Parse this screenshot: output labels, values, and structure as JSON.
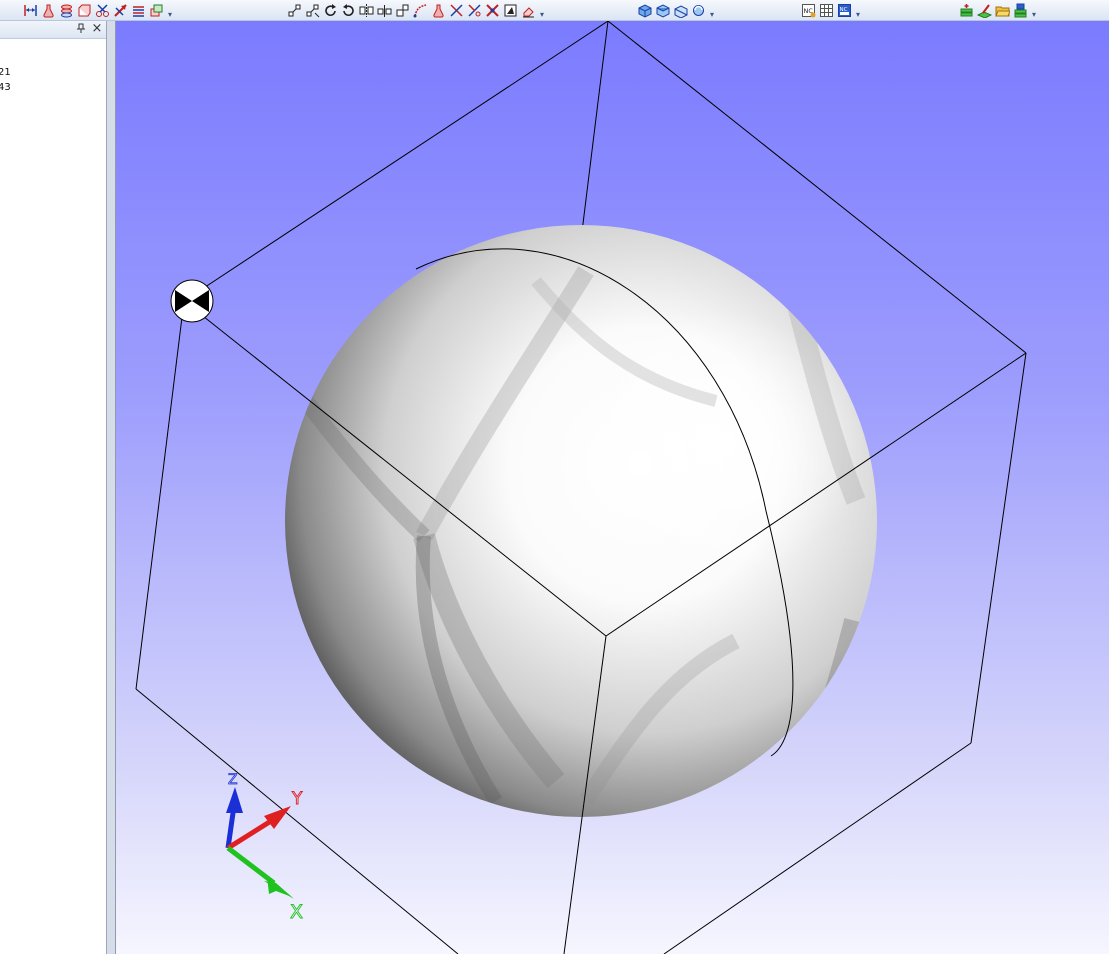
{
  "toolbar": {
    "groups": [
      {
        "id": "g1",
        "icons": [
          "dimension-icon",
          "flask-icon",
          "cylinder-stack-icon",
          "box-icon",
          "scissors-icon",
          "arrow-cut-icon",
          "layers-icon",
          "stack-boxes-icon"
        ]
      },
      {
        "id": "g2",
        "icons": [
          "node-add-icon",
          "node-remove-icon",
          "rotate-icon",
          "rotate-ccw-icon",
          "mirror-icon",
          "mirror-plane-icon",
          "scale-icon",
          "curve-icon",
          "flask-tool-icon",
          "cut-line-icon",
          "trim-icon",
          "cross-cut-icon",
          "frame-icon",
          "erase-icon"
        ]
      },
      {
        "id": "g3",
        "icons": [
          "view-iso-icon",
          "view-top-icon",
          "view-side-icon",
          "view-rotate-icon"
        ]
      },
      {
        "id": "g4",
        "icons": [
          "nc-icon",
          "grid-table-icon",
          "nc-export-icon"
        ]
      },
      {
        "id": "g5",
        "icons": [
          "add-layer-icon",
          "pencil-plane-icon",
          "open-folder-icon",
          "save-stack-icon"
        ]
      }
    ]
  },
  "side_panel": {
    "pin_glyph": "ᵖ",
    "close_glyph": "×",
    "items": [
      "21",
      "43"
    ]
  },
  "viewport": {
    "background_top": "#7b7bff",
    "background_bottom": "#f6f6ff",
    "axes": {
      "x_label": "X",
      "y_label": "Y",
      "z_label": "Z",
      "x_color": "#1fc21f",
      "y_color": "#e02020",
      "z_color": "#1a2fd6"
    }
  }
}
